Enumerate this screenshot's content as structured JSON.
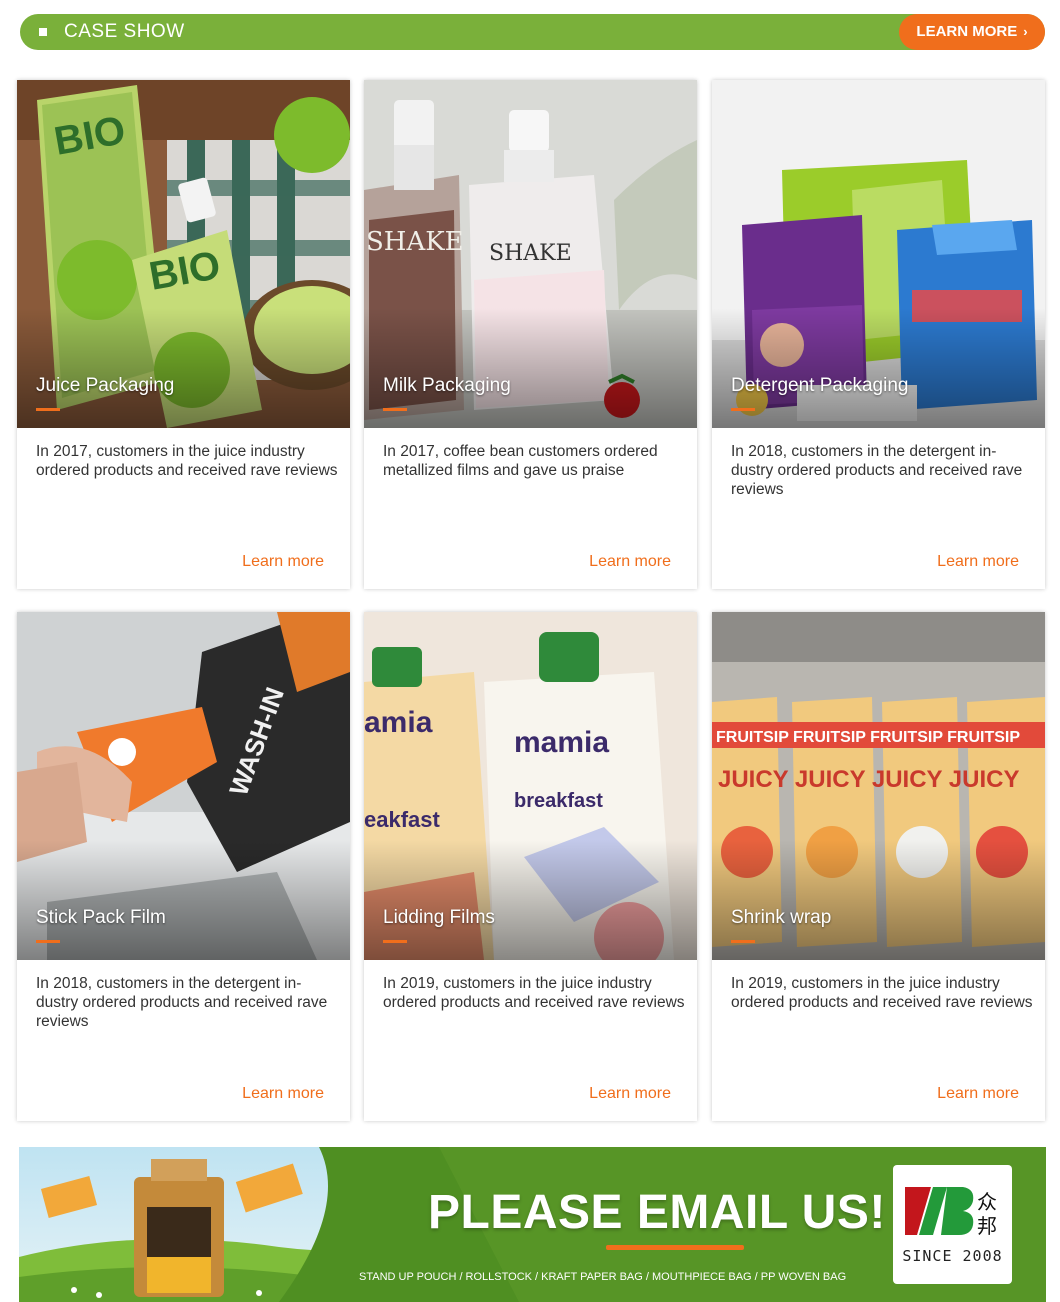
{
  "header": {
    "title": "CASE SHOW",
    "learn_more": "LEARN MORE"
  },
  "cards": [
    {
      "title": "Juice Packaging",
      "description": "In 2017, customers in the juice industry ordered products and received rave reviews",
      "link": "Learn more"
    },
    {
      "title": "Milk Packaging",
      "description": "In 2017, coffee bean customers ordered metallized films and gave us praise",
      "link": "Learn more"
    },
    {
      "title": "Detergent Packaging",
      "description": "In 2018, customers in the detergent in-dustry ordered products and received rave reviews",
      "link": "Learn more"
    },
    {
      "title": "Stick Pack Film",
      "description": "In 2018, customers in the detergent in-dustry ordered products and received rave reviews",
      "link": "Learn more"
    },
    {
      "title": "Lidding Films",
      "description": "In 2019, customers in the juice industry ordered products and received rave reviews",
      "link": "Learn more"
    },
    {
      "title": "Shrink wrap",
      "description": "In 2019, customers in the juice industry ordered products and received rave reviews",
      "link": "Learn more"
    }
  ],
  "banner": {
    "title": "PLEASE EMAIL US!",
    "subtitle": "STAND UP POUCH / ROLLSTOCK / KRAFT PAPER BAG / MOUTHPIECE BAG / PP WOVEN BAG",
    "logo_since": "SINCE 2008"
  },
  "colors": {
    "brand_green": "#7ab03a",
    "accent_orange": "#f06e1c"
  }
}
